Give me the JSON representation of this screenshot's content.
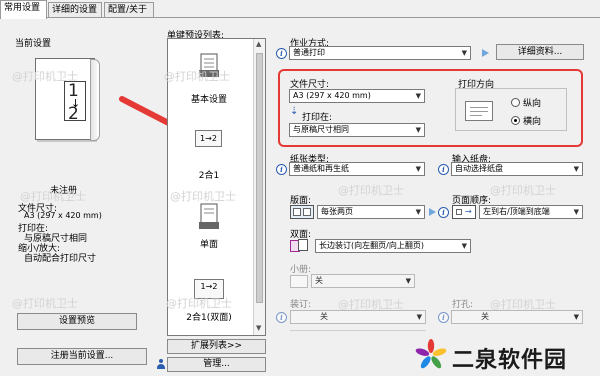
{
  "tabs": [
    "常用设置",
    "详细的设置",
    "配置/关于"
  ],
  "left": {
    "current_settings_label": "当前设置",
    "preview_digits": [
      "1",
      "2"
    ],
    "status_label": "未注册",
    "details": {
      "paper_size_label": "文件尺寸:",
      "paper_size_value": "A3 (297 x 420 mm)",
      "print_on_label": "打印在:",
      "print_on_value": "与原稿尺寸相同",
      "zoom_label": "缩小/放大:",
      "zoom_value": "自动配合打印尺寸"
    },
    "preview_button": "设置预览",
    "register_button": "注册当前设置..."
  },
  "presets": {
    "label": "单键预设列表:",
    "items": [
      {
        "name": "基本设置",
        "icon": "printer-doc-icon"
      },
      {
        "name": "2合1",
        "icon": "two-in-one-icon"
      },
      {
        "name": "单面",
        "icon": "single-sided-icon"
      },
      {
        "name": "2合1(双面)",
        "icon": "two-in-one-duplex-icon"
      }
    ],
    "icon_text": "1→2",
    "expand_button": "扩展列表>>",
    "manage_button": "管理..."
  },
  "form": {
    "job_type_label": "作业方式:",
    "job_type_value": "普通打印",
    "details_button": "详细资料...",
    "paper_size_label": "文件尺寸:",
    "paper_size_value": "A3 (297 x 420 mm)",
    "print_on_label": "打印在:",
    "print_on_value": "与原稿尺寸相同",
    "orientation_label": "打印方向",
    "orientation_portrait": "纵向",
    "orientation_landscape": "横向",
    "orientation_selected": "横向",
    "paper_type_label": "纸张类型:",
    "paper_type_value": "普通纸和再生纸",
    "input_tray_label": "输入纸盘:",
    "input_tray_value": "自动选择纸盘",
    "layout_label": "版面:",
    "layout_value": "每张两页",
    "page_order_label": "页面顺序:",
    "page_order_value": "左到右/顶端到底端",
    "duplex_label": "双面:",
    "duplex_value": "长边装订(向左翻页/向上翻页)",
    "booklet_label": "小册:",
    "booklet_value": "关",
    "staple_label": "装订:",
    "staple_value": "关",
    "punch_label": "打孔:",
    "punch_value": "关"
  },
  "watermark": "@打印机卫士",
  "brand": {
    "name": "二泉软件园",
    "colors": [
      "#e53935",
      "#fbc02d",
      "#43a047",
      "#1e88e5",
      "#8e24aa"
    ]
  },
  "accent": {
    "annotation_red": "#e53935",
    "play_blue": "#6fa6dc"
  }
}
